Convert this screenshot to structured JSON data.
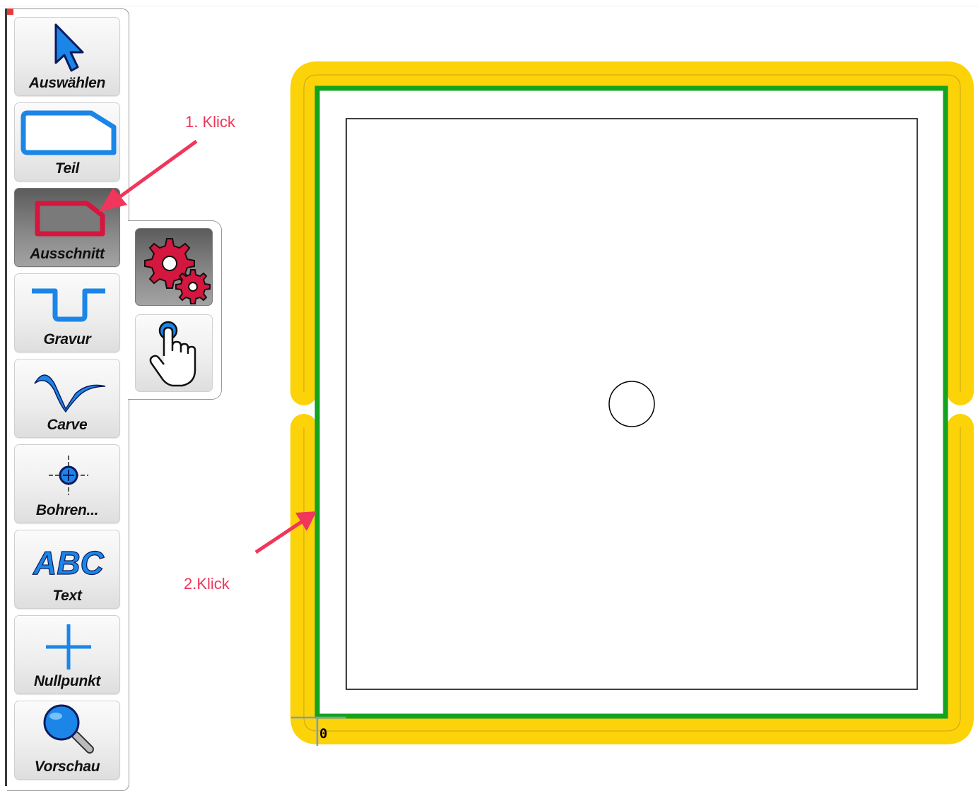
{
  "toolbar": {
    "items": [
      {
        "label": "Auswählen",
        "icon": "pointer-arrow-icon"
      },
      {
        "label": "Teil",
        "icon": "part-shape-icon"
      },
      {
        "label": "Ausschnitt",
        "icon": "cutout-shape-icon",
        "active": true
      },
      {
        "label": "Gravur",
        "icon": "engrave-icon"
      },
      {
        "label": "Carve",
        "icon": "carve-wave-icon"
      },
      {
        "label": "Bohren...",
        "icon": "drill-crosshair-icon"
      },
      {
        "label": "Text",
        "icon": "abc-text-icon"
      },
      {
        "label": "Nullpunkt",
        "icon": "plus-origin-icon"
      },
      {
        "label": "Vorschau",
        "icon": "magnifier-icon"
      }
    ]
  },
  "subtoolbar": {
    "items": [
      {
        "icon": "gears-icon",
        "active": true
      },
      {
        "icon": "hand-pointer-icon",
        "active": false
      }
    ]
  },
  "annotations": {
    "first_click": "1. Klick",
    "second_click": "2.Klick",
    "arrow_color": "#f0365a"
  },
  "canvas": {
    "origin_label": "0",
    "toolpath_color": "#fcd209",
    "contour_color": "#13a31e",
    "outline_color": "#000000"
  },
  "colors": {
    "icon_blue": "#1b86e8",
    "icon_red": "#d5163f"
  }
}
